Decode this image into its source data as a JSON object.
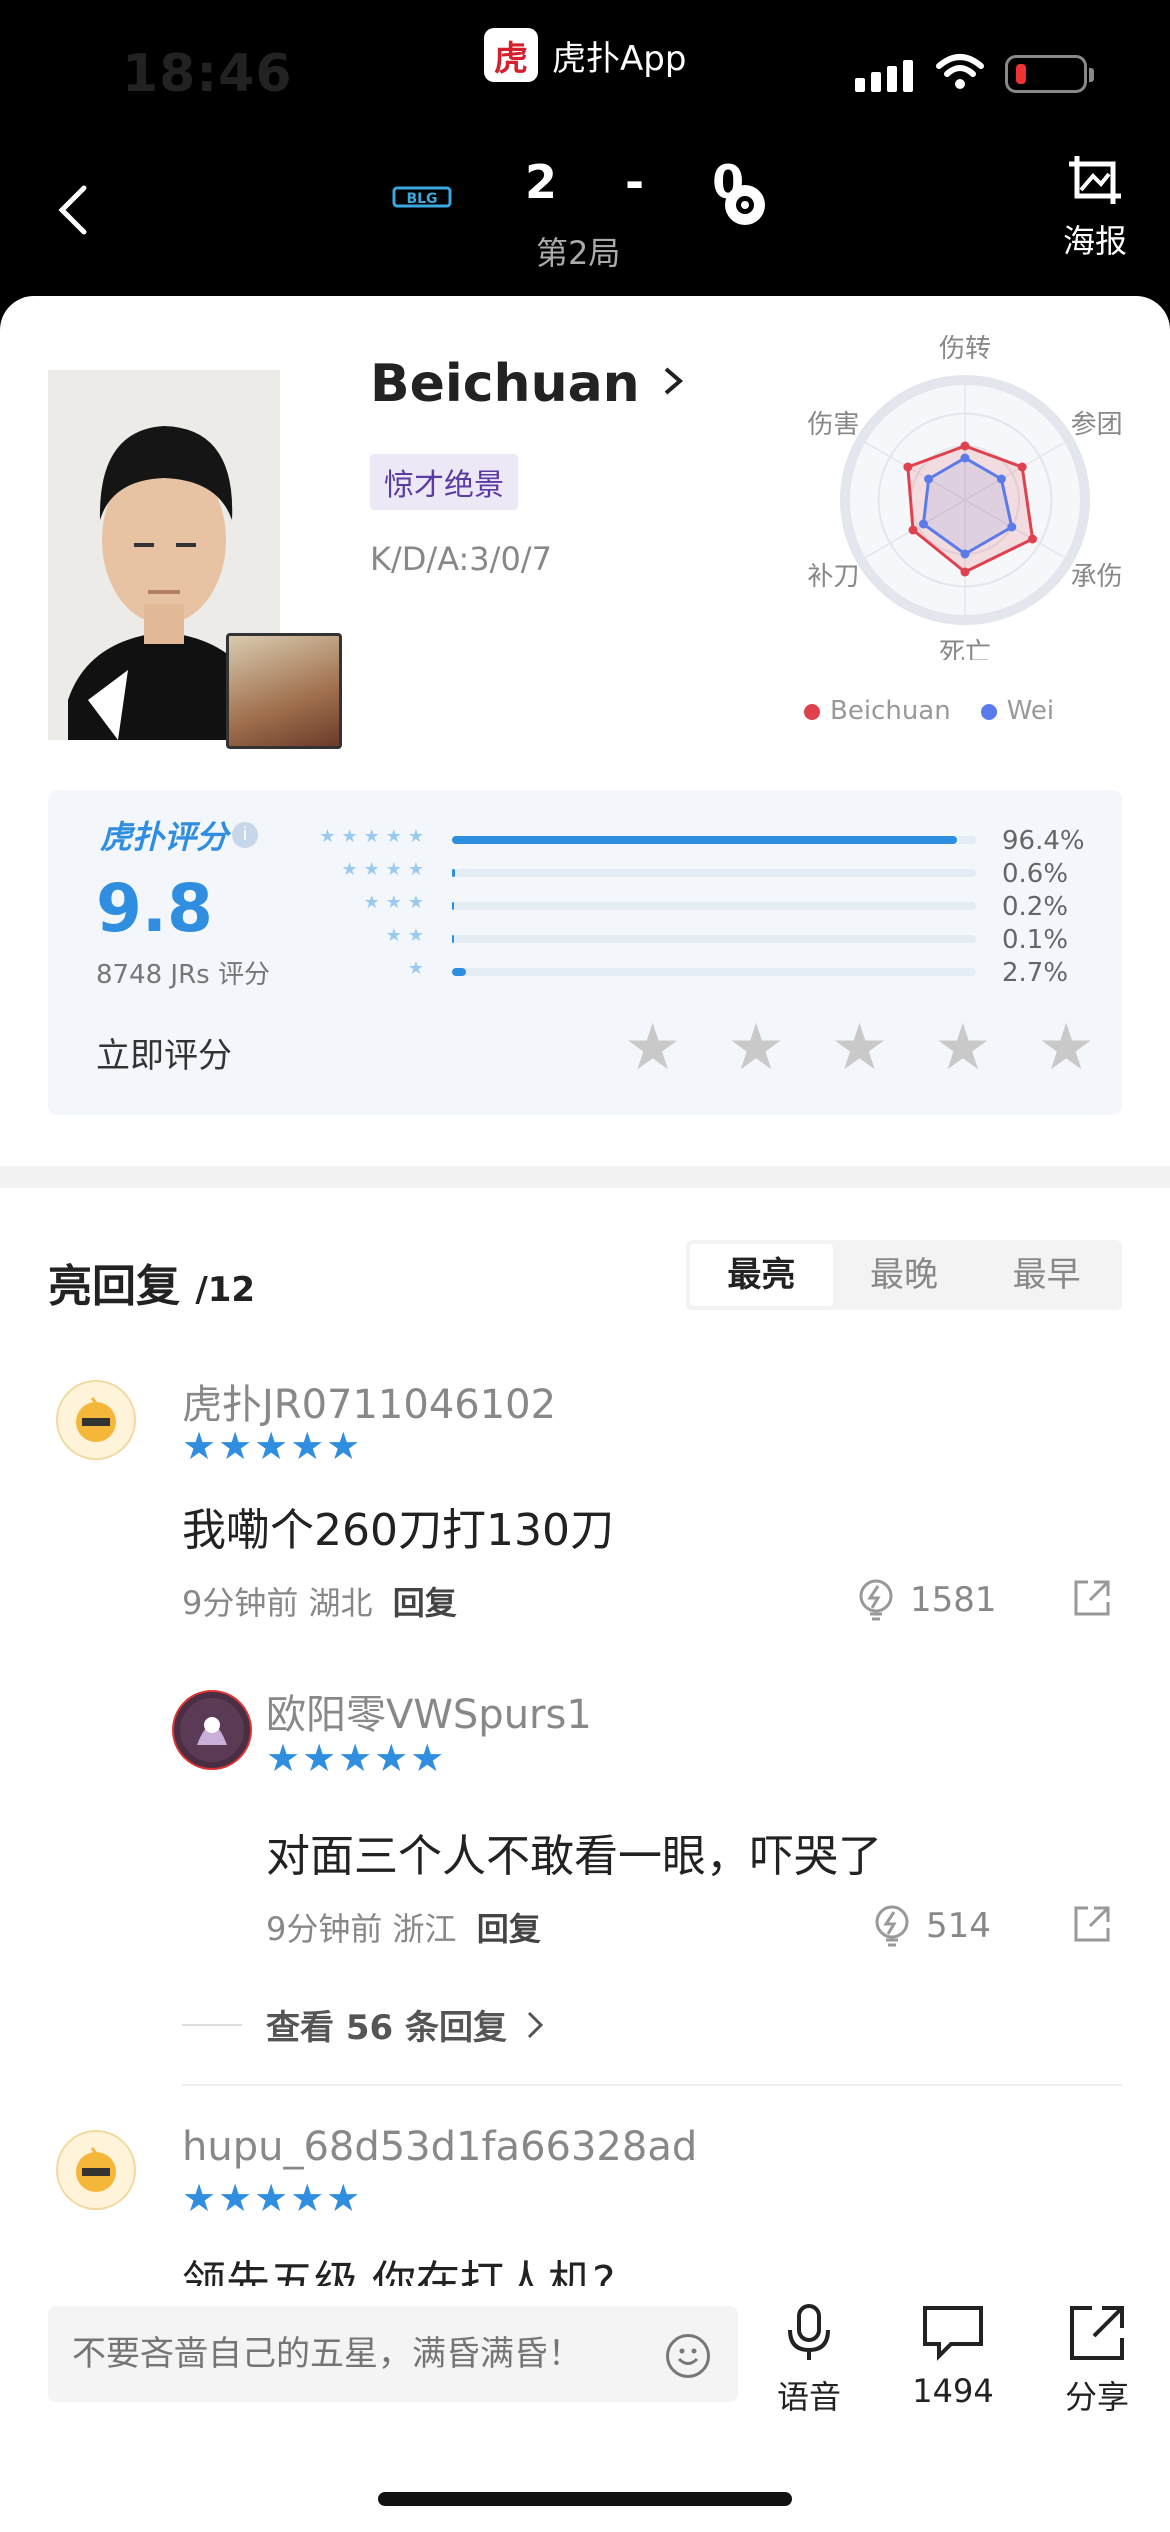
{
  "status_bar": {
    "time": "18:46",
    "app_name": "虎扑App",
    "app_logo": "虎扑"
  },
  "header": {
    "score": "2 - 0",
    "game_label": "第2局",
    "team_a_logo": "BLG",
    "poster_label": "海报"
  },
  "player": {
    "name": "Beichuan",
    "tag": "惊才绝景",
    "kda": "K/D/A:3/0/7"
  },
  "radar": {
    "axes": [
      "伤转",
      "参团",
      "承伤",
      "死亡",
      "补刀",
      "伤害"
    ],
    "series": [
      {
        "name": "Beichuan",
        "color": "#e0414f",
        "values": [
          0.45,
          0.55,
          0.65,
          0.6,
          0.5,
          0.55
        ]
      },
      {
        "name": "Wei",
        "color": "#5b7be8",
        "values": [
          0.35,
          0.35,
          0.45,
          0.45,
          0.4,
          0.35
        ]
      }
    ]
  },
  "rating": {
    "logo": "虎扑评分",
    "score": "9.8",
    "count": "8748 JRs 评分",
    "rows": [
      {
        "stars": "★★★★★",
        "pct": "96.4%",
        "value": 96.4
      },
      {
        "stars": "★★★★",
        "pct": "0.6%",
        "value": 0.6
      },
      {
        "stars": "★★★",
        "pct": "0.2%",
        "value": 0.2
      },
      {
        "stars": "★★",
        "pct": "0.1%",
        "value": 0.1
      },
      {
        "stars": "★",
        "pct": "2.7%",
        "value": 2.7
      }
    ],
    "rate_now": "立即评分"
  },
  "replies": {
    "title": "亮回复",
    "count": "/12",
    "tabs": [
      "最亮",
      "最晚",
      "最早"
    ],
    "items": [
      {
        "user": "虎扑JR0711046102",
        "stars": "★★★★★",
        "text": "我嘞个260刀打130刀",
        "time": "9分钟前",
        "region": "湖北",
        "reply": "回复",
        "likes": "1581"
      },
      {
        "user": "欧阳零VWSpurs1",
        "stars": "★★★★★",
        "text": "对面三个人不敢看一眼，吓哭了",
        "time": "9分钟前",
        "region": "浙江",
        "reply": "回复",
        "likes": "514"
      },
      {
        "user": "hupu_68d53d1fa66328ad",
        "stars": "★★★★★",
        "text": "领先五级 你在打人机?"
      }
    ],
    "more": "查看 56 条回复"
  },
  "bottom": {
    "placeholder": "不要吝啬自己的五星，满昏满昏！",
    "voice": "语音",
    "comments": "1494",
    "share": "分享"
  }
}
